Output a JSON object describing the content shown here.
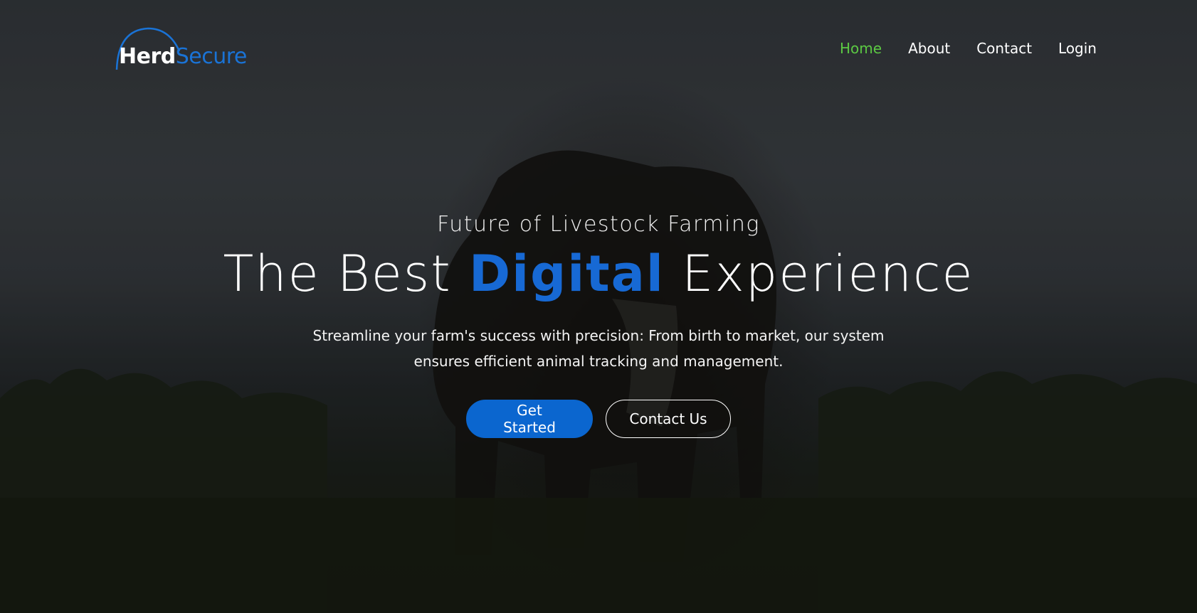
{
  "brand": {
    "name_part1": "Herd",
    "name_part2": "Secure",
    "color_part1": "#ffffff",
    "color_part2": "#1a73d6"
  },
  "nav": {
    "items": [
      {
        "label": "Home",
        "active": true
      },
      {
        "label": "About",
        "active": false
      },
      {
        "label": "Contact",
        "active": false
      },
      {
        "label": "Login",
        "active": false
      }
    ],
    "active_color": "#5cc943"
  },
  "hero": {
    "kicker": "Future of Livestock Farming",
    "headline_prefix": "The Best",
    "headline_accent": "Digital",
    "headline_suffix": "Experience",
    "accent_color": "#1769d4",
    "description": "Streamline your farm's success with precision: From birth to market, our system ensures efficient animal tracking and management.",
    "primary_button": "Get Started",
    "secondary_button": "Contact Us"
  }
}
